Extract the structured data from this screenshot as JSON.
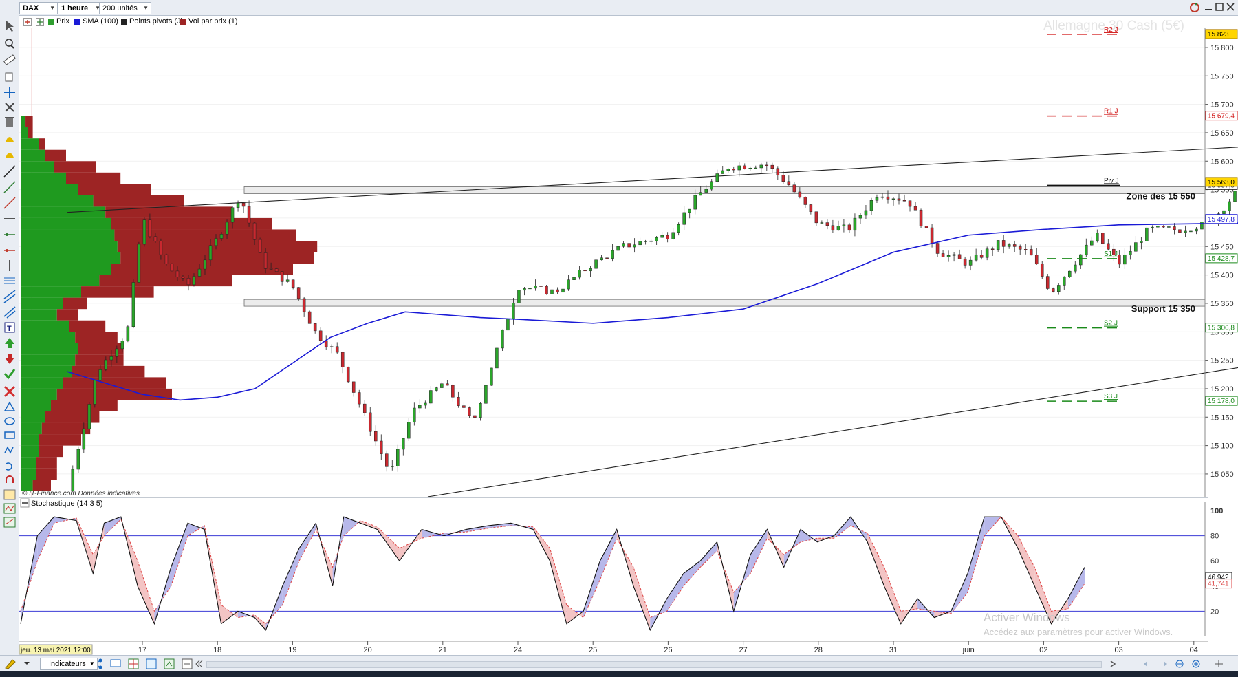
{
  "toolbar": {
    "symbol": "DAX",
    "timeframe": "1 heure",
    "units": "200 unités"
  },
  "legend": [
    {
      "label": "Prix",
      "color": "#2e9e2e"
    },
    {
      "label": "SMA (100)",
      "color": "#1a1ad6"
    },
    {
      "label": "Points pivots (J)",
      "color": "#222222"
    },
    {
      "label": "Vol par prix (1)",
      "color": "#9d2424"
    }
  ],
  "watermark": "Allemagne 30 Cash (5€)",
  "source_note": "© IT-Finance.com  Données indicatives",
  "stoch_title": "Stochastique (14 3 5)",
  "windows_notice": {
    "title": "Activer Windows",
    "subtitle": "Accédez aux paramètres pour activer Windows."
  },
  "bottom": {
    "indicators_button": "Indicateurs",
    "current_date": "jeu. 13 mai 2021 12:00"
  },
  "colors": {
    "up": "#2aa52a",
    "down": "#c8282f",
    "vp_up": "#1f9a1f",
    "vp_down": "#9d2424",
    "sma": "#1a1ad6",
    "resistance": "#d01010",
    "support": "#1a8a1a"
  },
  "chart_data": {
    "type": "candlestick",
    "title": "Allemagne 30 Cash (5€)",
    "timeframe": "1 heure",
    "x_tick_labels": [
      "17",
      "18",
      "19",
      "20",
      "21",
      "24",
      "25",
      "26",
      "27",
      "28",
      "31",
      "juin",
      "02",
      "03",
      "04"
    ],
    "y_ticks": [
      15050,
      15100,
      15150,
      15200,
      15250,
      15300,
      15350,
      15400,
      15450,
      15500,
      15550,
      15600,
      15650,
      15700,
      15750,
      15800
    ],
    "y_tick_labels": [
      "15 050",
      "15 100",
      "15 150",
      "15 200",
      "15 250",
      "15 300",
      "15 350",
      "15 400",
      "15 450",
      "15 500",
      "15 550",
      "15 600",
      "15 650",
      "15 700",
      "15 750",
      "15 800"
    ],
    "ylim": [
      15010,
      15835
    ],
    "last_price": "15 563,0",
    "pivots": [
      {
        "name": "R2 J",
        "value": 15823.0,
        "label": "15 823",
        "kind": "resistance"
      },
      {
        "name": "R1 J",
        "value": 15679.4,
        "label": "15 679,4",
        "kind": "resistance"
      },
      {
        "name": "Piv J",
        "value": 15557.5,
        "label": "15 557,5",
        "kind": "pivot"
      },
      {
        "name": "S1 J",
        "value": 15428.7,
        "label": "15 428,7",
        "kind": "support"
      },
      {
        "name": "S2 J",
        "value": 15306.8,
        "label": "15 306,8",
        "kind": "support"
      },
      {
        "name": "S3 J",
        "value": 15178.0,
        "label": "15 178,0",
        "kind": "support"
      }
    ],
    "sma_last": {
      "value": 15497.8,
      "label": "15 497,8"
    },
    "zones": [
      {
        "label": "Zone des 15 550",
        "low": 15543,
        "high": 15555
      },
      {
        "label": "Support 15 350",
        "low": 15345,
        "high": 15357
      }
    ],
    "close_path": [
      {
        "x": 0.0,
        "y": 15020
      },
      {
        "x": 0.4,
        "y": 15230
      },
      {
        "x": 0.8,
        "y": 15300
      },
      {
        "x": 1.0,
        "y": 15500
      },
      {
        "x": 1.3,
        "y": 15420
      },
      {
        "x": 1.6,
        "y": 15380
      },
      {
        "x": 2.0,
        "y": 15465
      },
      {
        "x": 2.3,
        "y": 15540
      },
      {
        "x": 2.6,
        "y": 15420
      },
      {
        "x": 3.0,
        "y": 15380
      },
      {
        "x": 3.3,
        "y": 15300
      },
      {
        "x": 3.6,
        "y": 15260
      },
      {
        "x": 4.0,
        "y": 15140
      },
      {
        "x": 4.3,
        "y": 15050
      },
      {
        "x": 4.6,
        "y": 15160
      },
      {
        "x": 5.0,
        "y": 15210
      },
      {
        "x": 5.4,
        "y": 15140
      },
      {
        "x": 5.8,
        "y": 15300
      },
      {
        "x": 6.0,
        "y": 15380
      },
      {
        "x": 6.5,
        "y": 15370
      },
      {
        "x": 7.0,
        "y": 15420
      },
      {
        "x": 7.4,
        "y": 15450
      },
      {
        "x": 8.0,
        "y": 15470
      },
      {
        "x": 8.4,
        "y": 15540
      },
      {
        "x": 8.8,
        "y": 15590
      },
      {
        "x": 9.3,
        "y": 15595
      },
      {
        "x": 9.6,
        "y": 15560
      },
      {
        "x": 10.0,
        "y": 15490
      },
      {
        "x": 10.4,
        "y": 15480
      },
      {
        "x": 10.8,
        "y": 15545
      },
      {
        "x": 11.2,
        "y": 15530
      },
      {
        "x": 11.6,
        "y": 15440
      },
      {
        "x": 12.0,
        "y": 15420
      },
      {
        "x": 12.4,
        "y": 15455
      },
      {
        "x": 12.8,
        "y": 15440
      },
      {
        "x": 13.1,
        "y": 15370
      },
      {
        "x": 13.4,
        "y": 15420
      },
      {
        "x": 13.7,
        "y": 15470
      },
      {
        "x": 14.0,
        "y": 15420
      },
      {
        "x": 14.4,
        "y": 15480
      },
      {
        "x": 14.8,
        "y": 15480
      },
      {
        "x": 15.2,
        "y": 15490
      },
      {
        "x": 15.6,
        "y": 15550
      },
      {
        "x": 16.0,
        "y": 15500
      },
      {
        "x": 16.4,
        "y": 15480
      },
      {
        "x": 16.8,
        "y": 15470
      },
      {
        "x": 17.2,
        "y": 15490
      },
      {
        "x": 17.6,
        "y": 15460
      },
      {
        "x": 18.0,
        "y": 15430
      },
      {
        "x": 18.4,
        "y": 15440
      },
      {
        "x": 18.8,
        "y": 15450
      },
      {
        "x": 19.2,
        "y": 15460
      },
      {
        "x": 19.5,
        "y": 15620
      },
      {
        "x": 19.8,
        "y": 15660
      },
      {
        "x": 20.05,
        "y": 15685
      },
      {
        "x": 20.3,
        "y": 15600
      },
      {
        "x": 20.6,
        "y": 15570
      },
      {
        "x": 20.9,
        "y": 15590
      },
      {
        "x": 21.2,
        "y": 15560
      },
      {
        "x": 21.5,
        "y": 15595
      },
      {
        "x": 21.8,
        "y": 15585
      },
      {
        "x": 22.0,
        "y": 15563
      }
    ],
    "sma_100": [
      {
        "x": 0.0,
        "y": 15230
      },
      {
        "x": 1.0,
        "y": 15190
      },
      {
        "x": 1.5,
        "y": 15180
      },
      {
        "x": 2.0,
        "y": 15185
      },
      {
        "x": 2.5,
        "y": 15200
      },
      {
        "x": 3.0,
        "y": 15245
      },
      {
        "x": 3.5,
        "y": 15290
      },
      {
        "x": 4.0,
        "y": 15315
      },
      {
        "x": 4.5,
        "y": 15335
      },
      {
        "x": 5.0,
        "y": 15330
      },
      {
        "x": 5.5,
        "y": 15325
      },
      {
        "x": 6.0,
        "y": 15322
      },
      {
        "x": 7.0,
        "y": 15315
      },
      {
        "x": 8.0,
        "y": 15325
      },
      {
        "x": 9.0,
        "y": 15340
      },
      {
        "x": 10.0,
        "y": 15385
      },
      {
        "x": 11.0,
        "y": 15440
      },
      {
        "x": 12.0,
        "y": 15470
      },
      {
        "x": 13.0,
        "y": 15480
      },
      {
        "x": 14.0,
        "y": 15488
      },
      {
        "x": 15.0,
        "y": 15490
      },
      {
        "x": 16.0,
        "y": 15492
      },
      {
        "x": 17.0,
        "y": 15480
      },
      {
        "x": 18.0,
        "y": 15470
      },
      {
        "x": 19.0,
        "y": 15465
      },
      {
        "x": 19.7,
        "y": 15463
      },
      {
        "x": 20.5,
        "y": 15476
      },
      {
        "x": 21.3,
        "y": 15488
      },
      {
        "x": 22.0,
        "y": 15497.8
      }
    ],
    "volume_profile": [
      {
        "price": 15670,
        "up": 8,
        "down": 12
      },
      {
        "price": 15650,
        "up": 12,
        "down": 8
      },
      {
        "price": 15630,
        "up": 30,
        "down": 10
      },
      {
        "price": 15610,
        "up": 40,
        "down": 35
      },
      {
        "price": 15590,
        "up": 55,
        "down": 70
      },
      {
        "price": 15570,
        "up": 75,
        "down": 90
      },
      {
        "price": 15550,
        "up": 95,
        "down": 120
      },
      {
        "price": 15530,
        "up": 120,
        "down": 150
      },
      {
        "price": 15510,
        "up": 140,
        "down": 210
      },
      {
        "price": 15490,
        "up": 150,
        "down": 265
      },
      {
        "price": 15470,
        "up": 155,
        "down": 300
      },
      {
        "price": 15450,
        "up": 160,
        "down": 330
      },
      {
        "price": 15430,
        "up": 165,
        "down": 320
      },
      {
        "price": 15410,
        "up": 150,
        "down": 300
      },
      {
        "price": 15390,
        "up": 130,
        "down": 220
      },
      {
        "price": 15370,
        "up": 100,
        "down": 120
      },
      {
        "price": 15350,
        "up": 70,
        "down": 40
      },
      {
        "price": 15330,
        "up": 60,
        "down": 35
      },
      {
        "price": 15310,
        "up": 80,
        "down": 60
      },
      {
        "price": 15290,
        "up": 90,
        "down": 70
      },
      {
        "price": 15270,
        "up": 95,
        "down": 75
      },
      {
        "price": 15250,
        "up": 90,
        "down": 80
      },
      {
        "price": 15230,
        "up": 85,
        "down": 120
      },
      {
        "price": 15210,
        "up": 70,
        "down": 170
      },
      {
        "price": 15190,
        "up": 60,
        "down": 190
      },
      {
        "price": 15170,
        "up": 50,
        "down": 110
      },
      {
        "price": 15150,
        "up": 40,
        "down": 90
      },
      {
        "price": 15130,
        "up": 35,
        "down": 80
      },
      {
        "price": 15110,
        "up": 30,
        "down": 70
      },
      {
        "price": 15090,
        "up": 30,
        "down": 40
      },
      {
        "price": 15070,
        "up": 25,
        "down": 35
      },
      {
        "price": 15050,
        "up": 25,
        "down": 35
      },
      {
        "price": 15030,
        "up": 20,
        "down": 30
      }
    ],
    "trendlines": [
      {
        "name": "upper-channel",
        "from": {
          "x": 0.0,
          "y": 15510
        },
        "to": {
          "x": 23.1,
          "y": 15680
        }
      },
      {
        "name": "lower-channel",
        "from": {
          "x": 4.8,
          "y": 15010
        },
        "to": {
          "x": 23.1,
          "y": 15395
        }
      }
    ],
    "stochastic": {
      "name": "Stochastique (14 3 5)",
      "ylim": [
        0,
        100
      ],
      "levels": [
        20,
        80
      ],
      "y_tick_labels": [
        "20",
        "40",
        "60",
        "80",
        "100"
      ],
      "k_last": {
        "value": 46.942,
        "label": "46,942"
      },
      "d_last": {
        "value": 41.741,
        "label": "41,741"
      },
      "k": [
        {
          "x": 0.0,
          "y": 10
        },
        {
          "x": 0.3,
          "y": 80
        },
        {
          "x": 0.6,
          "y": 95
        },
        {
          "x": 1.0,
          "y": 92
        },
        {
          "x": 1.3,
          "y": 50
        },
        {
          "x": 1.5,
          "y": 90
        },
        {
          "x": 1.8,
          "y": 95
        },
        {
          "x": 2.1,
          "y": 40
        },
        {
          "x": 2.4,
          "y": 10
        },
        {
          "x": 2.7,
          "y": 55
        },
        {
          "x": 3.0,
          "y": 90
        },
        {
          "x": 3.3,
          "y": 85
        },
        {
          "x": 3.6,
          "y": 10
        },
        {
          "x": 3.9,
          "y": 20
        },
        {
          "x": 4.2,
          "y": 15
        },
        {
          "x": 4.4,
          "y": 5
        },
        {
          "x": 4.7,
          "y": 40
        },
        {
          "x": 5.0,
          "y": 70
        },
        {
          "x": 5.3,
          "y": 90
        },
        {
          "x": 5.6,
          "y": 40
        },
        {
          "x": 5.8,
          "y": 95
        },
        {
          "x": 6.1,
          "y": 90
        },
        {
          "x": 6.4,
          "y": 85
        },
        {
          "x": 6.8,
          "y": 60
        },
        {
          "x": 7.2,
          "y": 85
        },
        {
          "x": 7.6,
          "y": 80
        },
        {
          "x": 8.0,
          "y": 85
        },
        {
          "x": 8.4,
          "y": 88
        },
        {
          "x": 8.8,
          "y": 90
        },
        {
          "x": 9.2,
          "y": 85
        },
        {
          "x": 9.5,
          "y": 60
        },
        {
          "x": 9.8,
          "y": 10
        },
        {
          "x": 10.1,
          "y": 20
        },
        {
          "x": 10.4,
          "y": 60
        },
        {
          "x": 10.7,
          "y": 85
        },
        {
          "x": 11.0,
          "y": 40
        },
        {
          "x": 11.3,
          "y": 5
        },
        {
          "x": 11.6,
          "y": 30
        },
        {
          "x": 11.9,
          "y": 50
        },
        {
          "x": 12.2,
          "y": 60
        },
        {
          "x": 12.5,
          "y": 75
        },
        {
          "x": 12.8,
          "y": 20
        },
        {
          "x": 13.1,
          "y": 65
        },
        {
          "x": 13.4,
          "y": 85
        },
        {
          "x": 13.7,
          "y": 55
        },
        {
          "x": 14.0,
          "y": 85
        },
        {
          "x": 14.3,
          "y": 75
        },
        {
          "x": 14.6,
          "y": 80
        },
        {
          "x": 14.9,
          "y": 95
        },
        {
          "x": 15.2,
          "y": 75
        },
        {
          "x": 15.5,
          "y": 40
        },
        {
          "x": 15.8,
          "y": 10
        },
        {
          "x": 16.1,
          "y": 30
        },
        {
          "x": 16.4,
          "y": 15
        },
        {
          "x": 16.7,
          "y": 20
        },
        {
          "x": 17.0,
          "y": 50
        },
        {
          "x": 17.3,
          "y": 95
        },
        {
          "x": 17.6,
          "y": 95
        },
        {
          "x": 17.9,
          "y": 70
        },
        {
          "x": 18.2,
          "y": 40
        },
        {
          "x": 18.5,
          "y": 10
        },
        {
          "x": 18.8,
          "y": 30
        },
        {
          "x": 19.1,
          "y": 55
        }
      ],
      "d": [
        {
          "x": 0.0,
          "y": 20
        },
        {
          "x": 0.3,
          "y": 60
        },
        {
          "x": 0.6,
          "y": 90
        },
        {
          "x": 1.0,
          "y": 94
        },
        {
          "x": 1.3,
          "y": 65
        },
        {
          "x": 1.5,
          "y": 80
        },
        {
          "x": 1.8,
          "y": 93
        },
        {
          "x": 2.1,
          "y": 60
        },
        {
          "x": 2.4,
          "y": 20
        },
        {
          "x": 2.7,
          "y": 40
        },
        {
          "x": 3.0,
          "y": 80
        },
        {
          "x": 3.3,
          "y": 88
        },
        {
          "x": 3.6,
          "y": 25
        },
        {
          "x": 3.9,
          "y": 15
        },
        {
          "x": 4.2,
          "y": 17
        },
        {
          "x": 4.4,
          "y": 10
        },
        {
          "x": 4.7,
          "y": 25
        },
        {
          "x": 5.0,
          "y": 60
        },
        {
          "x": 5.3,
          "y": 85
        },
        {
          "x": 5.6,
          "y": 55
        },
        {
          "x": 5.8,
          "y": 80
        },
        {
          "x": 6.1,
          "y": 92
        },
        {
          "x": 6.4,
          "y": 87
        },
        {
          "x": 6.8,
          "y": 70
        },
        {
          "x": 7.2,
          "y": 78
        },
        {
          "x": 7.6,
          "y": 82
        },
        {
          "x": 8.0,
          "y": 83
        },
        {
          "x": 8.4,
          "y": 86
        },
        {
          "x": 8.8,
          "y": 88
        },
        {
          "x": 9.2,
          "y": 87
        },
        {
          "x": 9.5,
          "y": 70
        },
        {
          "x": 9.8,
          "y": 25
        },
        {
          "x": 10.1,
          "y": 15
        },
        {
          "x": 10.4,
          "y": 45
        },
        {
          "x": 10.7,
          "y": 78
        },
        {
          "x": 11.0,
          "y": 55
        },
        {
          "x": 11.3,
          "y": 15
        },
        {
          "x": 11.6,
          "y": 20
        },
        {
          "x": 11.9,
          "y": 40
        },
        {
          "x": 12.2,
          "y": 55
        },
        {
          "x": 12.5,
          "y": 68
        },
        {
          "x": 12.8,
          "y": 35
        },
        {
          "x": 13.1,
          "y": 50
        },
        {
          "x": 13.4,
          "y": 78
        },
        {
          "x": 13.7,
          "y": 65
        },
        {
          "x": 14.0,
          "y": 75
        },
        {
          "x": 14.3,
          "y": 78
        },
        {
          "x": 14.6,
          "y": 78
        },
        {
          "x": 14.9,
          "y": 88
        },
        {
          "x": 15.2,
          "y": 82
        },
        {
          "x": 15.5,
          "y": 55
        },
        {
          "x": 15.8,
          "y": 20
        },
        {
          "x": 16.1,
          "y": 22
        },
        {
          "x": 16.4,
          "y": 20
        },
        {
          "x": 16.7,
          "y": 18
        },
        {
          "x": 17.0,
          "y": 35
        },
        {
          "x": 17.3,
          "y": 80
        },
        {
          "x": 17.6,
          "y": 95
        },
        {
          "x": 17.9,
          "y": 80
        },
        {
          "x": 18.2,
          "y": 55
        },
        {
          "x": 18.5,
          "y": 20
        },
        {
          "x": 18.8,
          "y": 22
        },
        {
          "x": 19.1,
          "y": 42
        }
      ]
    }
  }
}
